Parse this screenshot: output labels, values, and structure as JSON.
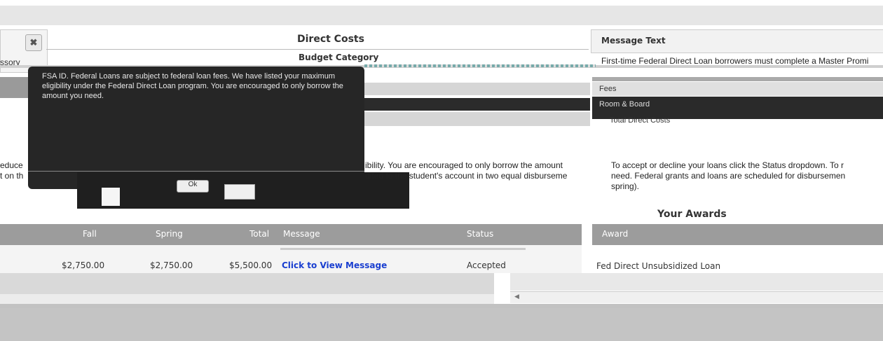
{
  "left_panel": {
    "close_glyph": "✖",
    "text": "ssory"
  },
  "direct_costs": {
    "title": "Direct Costs",
    "budget_category": "Budget Category"
  },
  "message_panel": {
    "title": "Message Text",
    "text": "First-time Federal Direct Loan borrowers must complete a Master Promi"
  },
  "budget_rows": {
    "fees": "Fees",
    "room_board": "Room & Board",
    "total_direct_costs": "Total Direct Costs"
  },
  "modal": {
    "text": "FSA ID. Federal Loans are subject to federal loan fees. We have listed your maximum eligibility under the Federal Direct Loan program. You are encouraged to only borrow the amount you need.",
    "ok_label": "Ok"
  },
  "paragraph_left": {
    "line1_start": "educe",
    "line2_start": "t on th",
    "line1_mid": "ibility. You are encouraged to only borrow the amount",
    "line2_mid": "dited to the student's account in two equal disburseme"
  },
  "paragraph_right": {
    "line1": "To accept or decline your loans click the Status dropdown. To r",
    "line2": "need. Federal grants and loans are scheduled for disbursemen",
    "line3": "spring)."
  },
  "awards": {
    "title": "Your Awards",
    "columns": {
      "fall": "Fall",
      "spring": "Spring",
      "total": "Total",
      "message": "Message",
      "status": "Status",
      "award": "Award"
    },
    "row": {
      "fall": "$2,750.00",
      "spring": "$2,750.00",
      "total": "$5,500.00",
      "message": "Click to View Message",
      "status": "Accepted",
      "award": "Fed Direct Unsubsidized Loan"
    }
  },
  "colors": {
    "link": "#1a3fd0",
    "table_header": "#9c9c9c",
    "modal_bg": "#262626"
  }
}
